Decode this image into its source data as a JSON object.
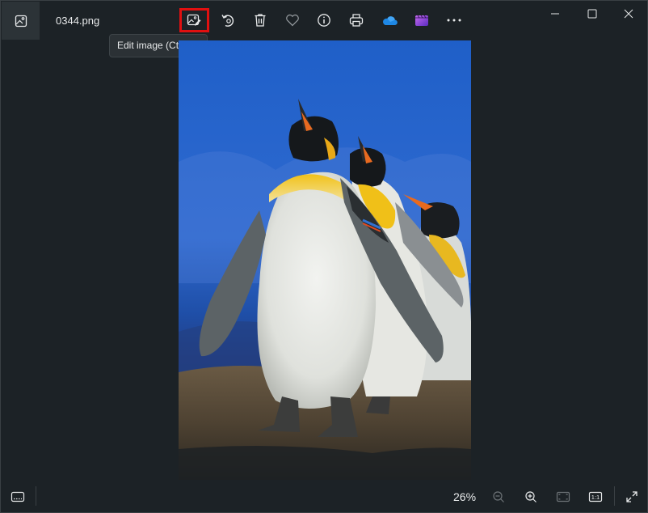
{
  "titlebar": {
    "file_name": "0344.png"
  },
  "toolbar": {
    "app_icon": "photos-gallery-icon",
    "edit_icon": "edit-image-icon",
    "rotate_icon": "rotate-icon",
    "delete_icon": "trash-icon",
    "favorite_icon": "heart-icon",
    "info_icon": "info-icon",
    "print_icon": "printer-icon",
    "onedrive_icon": "onedrive-cloud-icon",
    "clipchamp_icon": "clipchamp-icon",
    "more_icon": "more-dots-icon",
    "tooltip": "Edit image (Ctrl+E)"
  },
  "window_controls": {
    "minimize_icon": "minimize-icon",
    "maximize_icon": "maximize-icon",
    "close_icon": "close-icon"
  },
  "statusbar": {
    "filmstrip_icon": "filmstrip-icon",
    "zoom_level": "26%",
    "zoom_out_icon": "zoom-out-icon",
    "zoom_in_icon": "zoom-in-icon",
    "fit_icon": "fit-to-window-icon",
    "actual_size_label": "1:1",
    "fullscreen_icon": "fullscreen-icon"
  },
  "colors": {
    "background": "#1c2226",
    "highlight": "#e01010",
    "onedrive": "#1e88e5",
    "clipchamp": "#8a4ad8"
  }
}
